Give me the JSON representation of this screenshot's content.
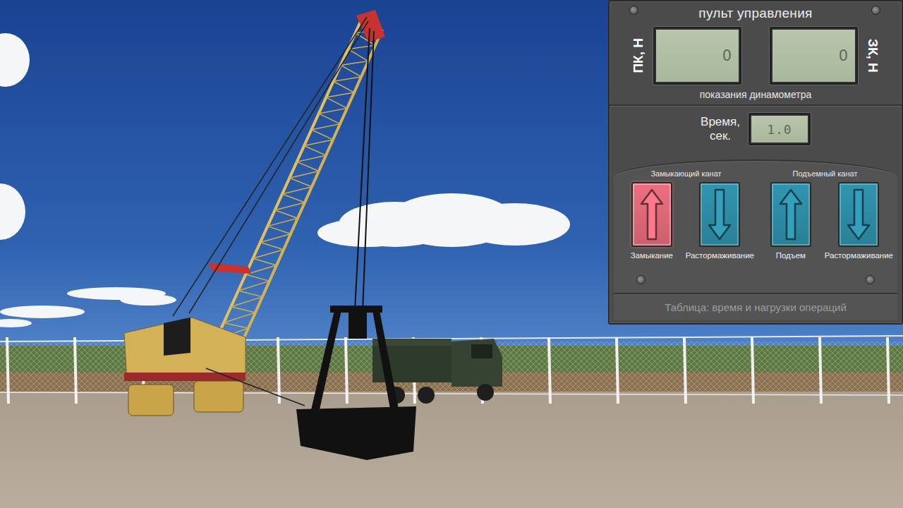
{
  "panel": {
    "title": "пульт управления",
    "dynamometer": {
      "caption": "показания динамометра",
      "channels": [
        {
          "label": "ПК, Н",
          "reading": "0"
        },
        {
          "label": "ЗК, Н",
          "reading": "0"
        }
      ]
    },
    "time": {
      "label_lines": [
        "Время,",
        "сек."
      ],
      "reading": "1.0"
    },
    "groups": [
      {
        "title": "Замыкающий канат",
        "buttons": [
          {
            "label": "Замыкание",
            "kind": "up",
            "selected": true,
            "color": "#e26b7a"
          },
          {
            "label": "Растормаживание",
            "kind": "down",
            "selected": false,
            "color": "#2f8ea8"
          }
        ]
      },
      {
        "title": "Подъемный канат",
        "buttons": [
          {
            "label": "Подъем",
            "kind": "up",
            "selected": false,
            "color": "#2f8ea8"
          },
          {
            "label": "Растормаживание",
            "kind": "down",
            "selected": false,
            "color": "#2f8ea8"
          }
        ]
      }
    ],
    "table_button": {
      "label": "Таблица: время и нагрузки операций",
      "disabled": true
    }
  }
}
